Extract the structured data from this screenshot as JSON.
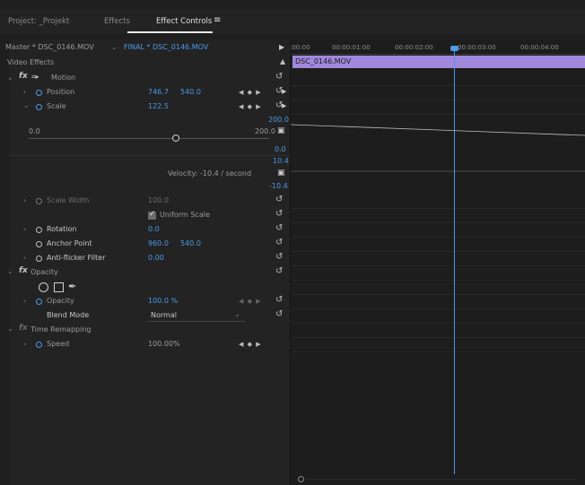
{
  "tabs": [
    {
      "label": "Project: _Projekt"
    },
    {
      "label": "Effects"
    },
    {
      "label": "Effect Controls"
    }
  ],
  "tab_menu_icon": "hamburger-icon",
  "header": {
    "master_clip": "Master * DSC_0146.MOV",
    "active_clip": "FINAL * DSC_0146.MOV"
  },
  "section": {
    "video_effects": "Video Effects"
  },
  "motion": {
    "label": "Motion",
    "position": {
      "label": "Position",
      "x": "746.7",
      "y": "540.0"
    },
    "scale": {
      "label": "Scale",
      "value": "122.5",
      "max_label": "200.0",
      "slider_min": "0.0",
      "slider_max": "200.0",
      "slider_fraction": 0.6125,
      "graph_top": "0.0",
      "velocity_top": "10.4",
      "velocity_text": "Velocity: -10.4 / second",
      "velocity_bottom": "-10.4"
    },
    "scale_width": {
      "label": "Scale Width",
      "value": "100.0"
    },
    "uniform_scale": {
      "label": "Uniform Scale",
      "checked": true
    },
    "rotation": {
      "label": "Rotation",
      "value": "0.0"
    },
    "anchor_point": {
      "label": "Anchor Point",
      "x": "960.0",
      "y": "540.0"
    },
    "anti_flicker": {
      "label": "Anti-flicker Filter",
      "value": "0.00"
    }
  },
  "opacity": {
    "label": "Opacity",
    "opacity_label": "Opacity",
    "opacity_value": "100.0 %",
    "blend_label": "Blend Mode",
    "blend_value": "Normal"
  },
  "time_remapping": {
    "label": "Time Remapping",
    "speed_label": "Speed",
    "speed_value": "100.00%"
  },
  "timeline": {
    "ticks": [
      ":00:00",
      "00:00:01:00",
      "00:00:02:00",
      "00:00:03:00",
      "00:00:04:00"
    ],
    "clip_label": "DSC_0146.MOV"
  },
  "colors": {
    "accent": "#4a9ae6",
    "clip": "#a088dc",
    "background": "#232323"
  }
}
